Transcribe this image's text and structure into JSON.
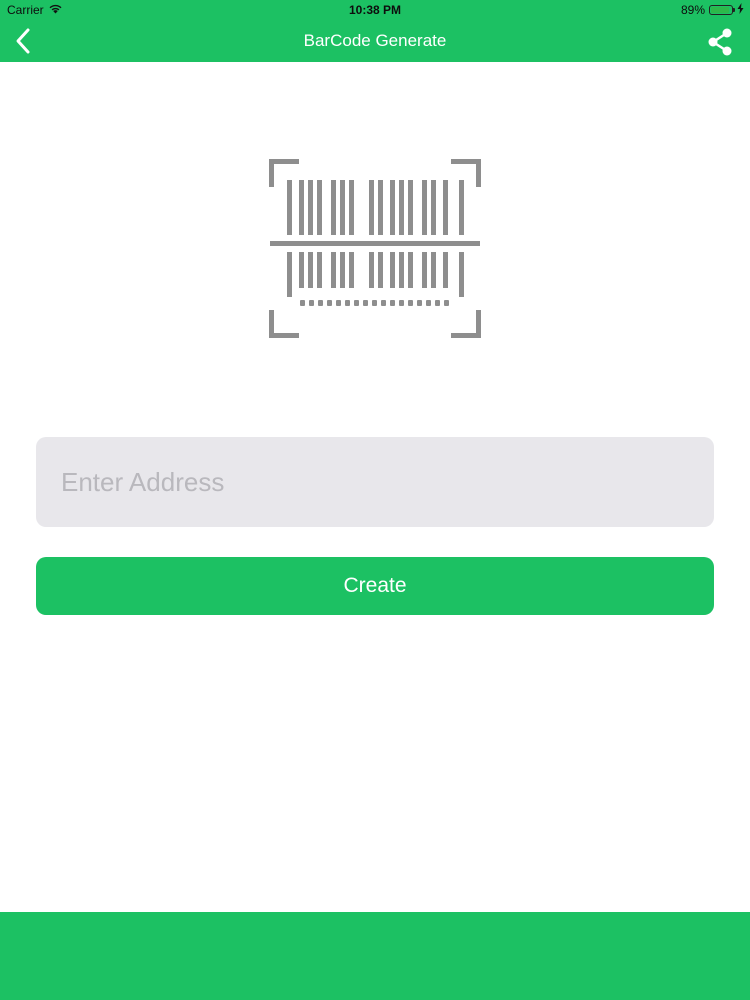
{
  "status_bar": {
    "carrier": "Carrier",
    "time": "10:38 PM",
    "battery_percent": "89%",
    "battery_level": 0.89,
    "icons": [
      "wifi-icon",
      "battery-icon",
      "charging-icon"
    ]
  },
  "nav": {
    "title": "BarCode Generate",
    "back_icon": "chevron-left-icon",
    "share_icon": "share-icon"
  },
  "illustration": {
    "icon": "barcode-scan-icon"
  },
  "form": {
    "address_placeholder": "Enter Address",
    "address_value": "",
    "create_label": "Create"
  },
  "colors": {
    "accent": "#1cc163",
    "input_bg": "#e8e7eb",
    "illustration": "#8e8e8e"
  }
}
